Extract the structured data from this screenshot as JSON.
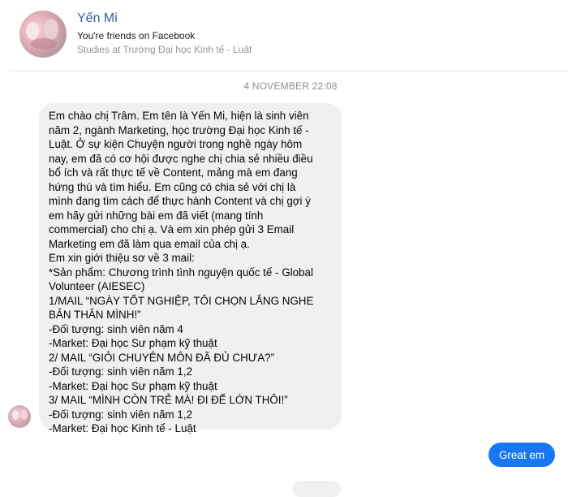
{
  "header": {
    "name": "Yến Mi",
    "friends_text": "You're friends on Facebook",
    "studies_text": "Studies at Trường Đại học Kinh tế - Luật"
  },
  "conversation": {
    "timestamp": "4 NOVEMBER 22:08",
    "incoming_message": {
      "lines": [
        "Em chào chị Trâm.  Em tên là Yến Mi, hiện là sinh viên",
        "năm 2, ngành Marketing, học trường Đại học Kinh tế -",
        "Luật. Ở sự kiện Chuyện người trong nghề ngày hôm",
        "nay, em đã có cơ hội được nghe chị chia sẻ nhiều điều",
        "bổ ích và rất thực tế về Content, mảng mà em đang",
        "hứng thú và tìm hiểu. Em cũng có chia sẻ với chị là",
        "mình đang tìm cách để thực hành Content và chị gợi ý",
        "em hãy gửi những bài em đã viết (mang tính",
        "commercial) cho chị ạ. Và em xin phép gửi 3 Email",
        "Marketing em đã làm qua email của chị ạ.",
        "Em xin giới thiệu sơ về 3 mail:",
        "*Sản phẩm: Chương trình tình nguyện quốc tế - Global",
        "Volunteer (AIESEC)",
        "1/MAIL “NGÀY TỐT NGHIỆP, TÔI CHỌN LẮNG NGHE",
        "BẢN THÂN MÌNH!”",
        "-Đối tượng: sinh viên năm 4",
        "-Market: Đại học Sư phạm kỹ thuật",
        "2/ MAIL “GIỎI CHUYÊN MÔN ĐÃ ĐỦ CHƯA?”",
        "-Đối tượng: sinh viên năm 1,2",
        "-Market: Đại học Sư phạm kỹ thuật",
        "3/ MAIL “MÌNH CÒN TRẺ MÀ! ĐI ĐỂ LỚN THÔI!”",
        "-Đối tượng: sinh viên năm 1,2",
        "-Market: Đại học Kinh tế - Luật"
      ]
    },
    "outgoing_message": "Great em"
  },
  "colors": {
    "name_link": "#385898",
    "outgoing_bubble": "#1877f2",
    "incoming_bubble": "#f0f0f0",
    "muted_text": "#90949c"
  }
}
